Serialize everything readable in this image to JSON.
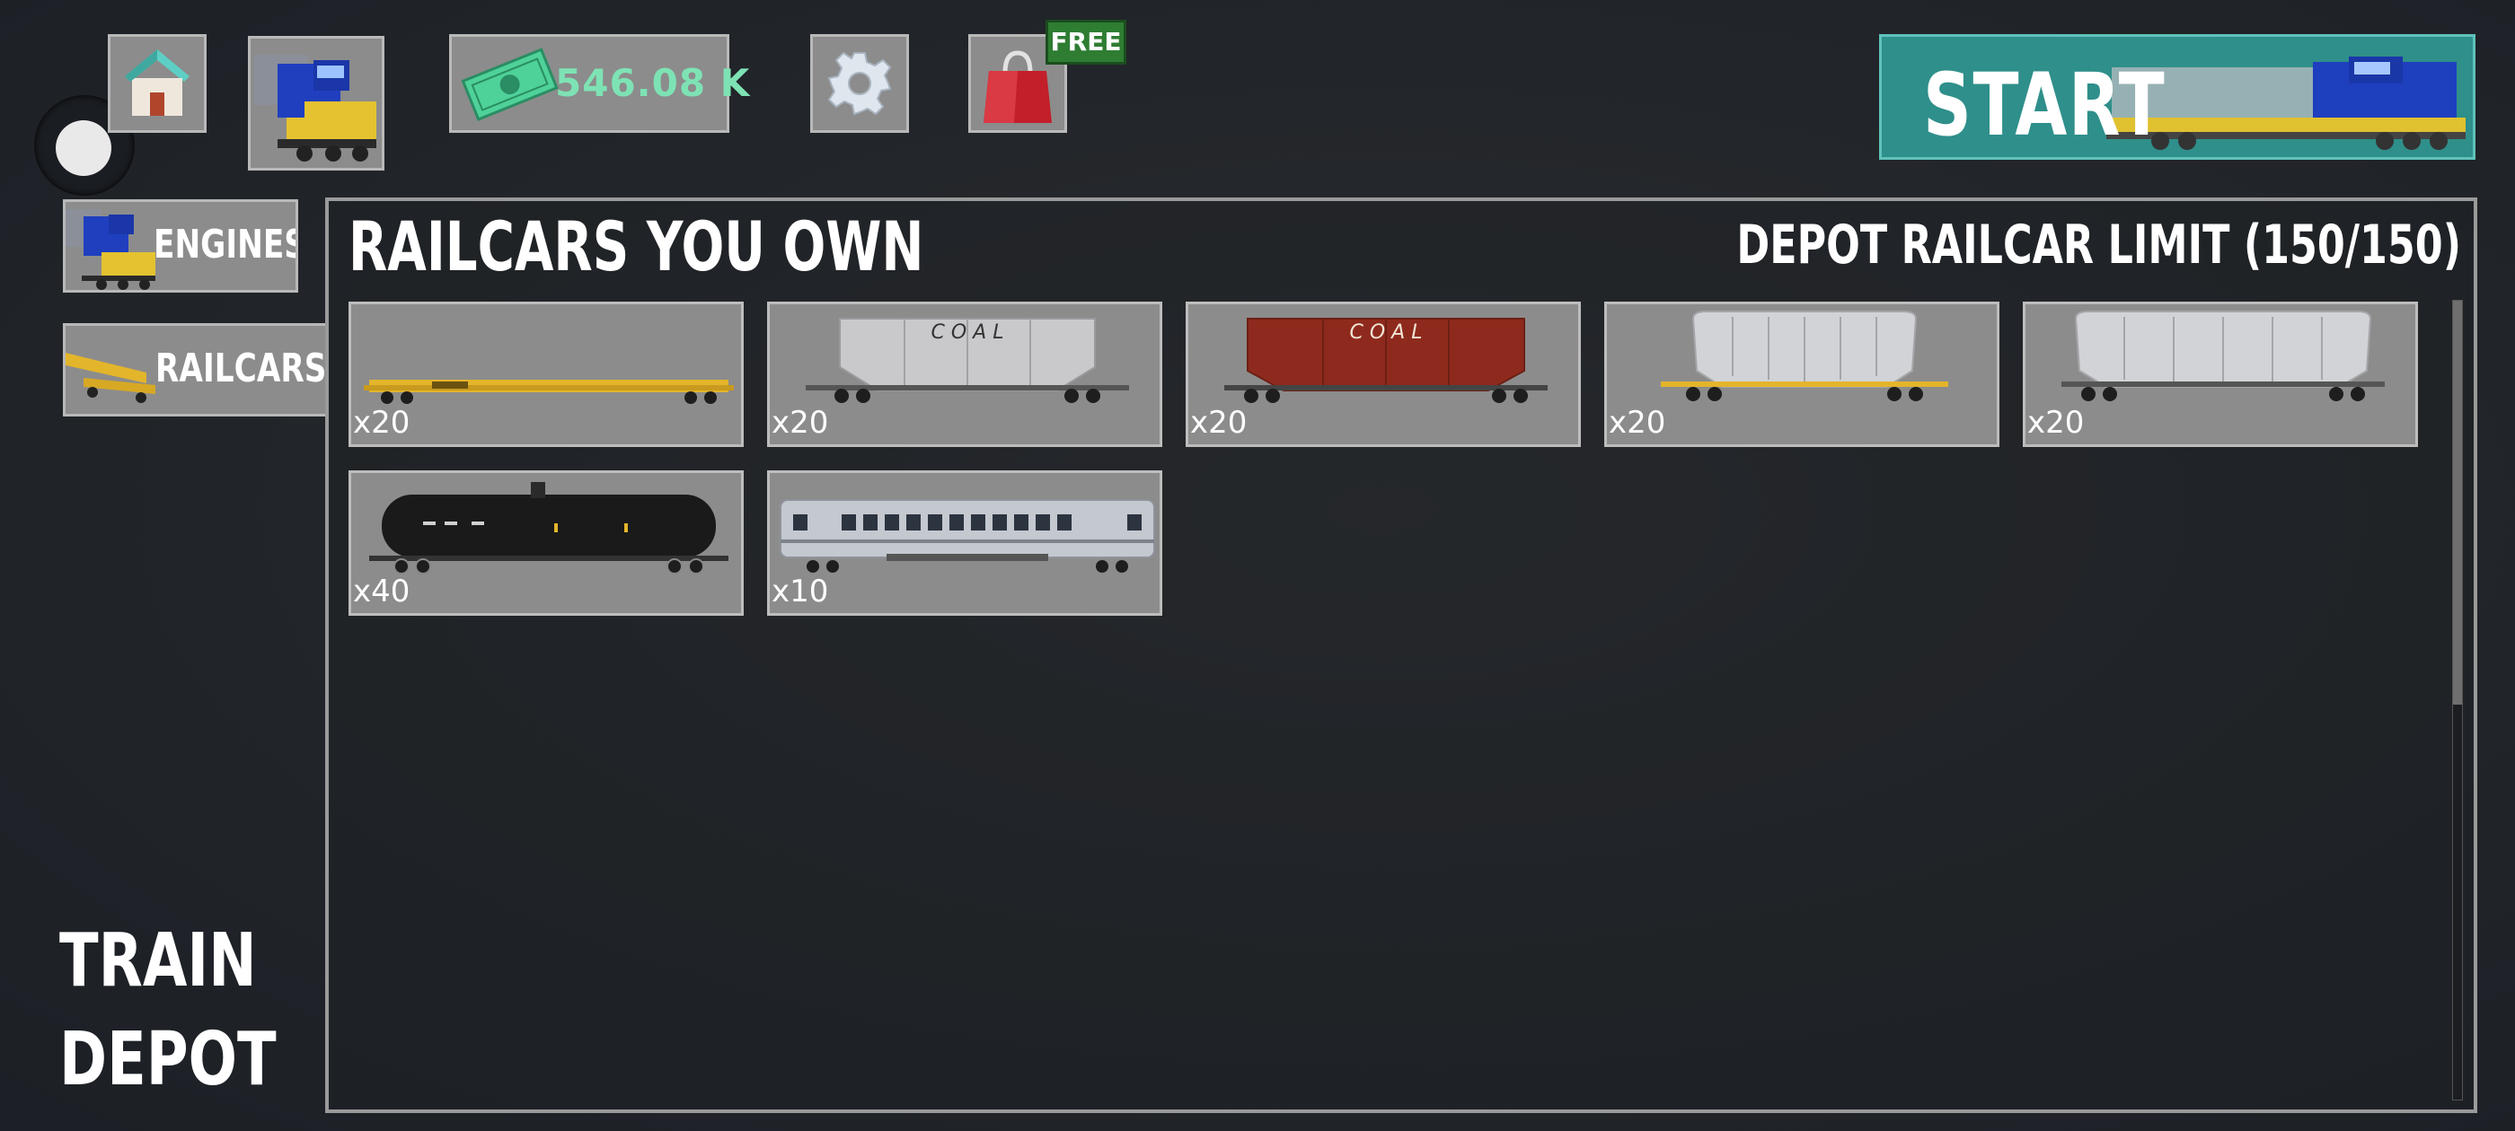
{
  "header": {
    "money": "546.08 K",
    "shop_badge": "FREE",
    "start_label": "START"
  },
  "icons": {
    "home": "house-icon",
    "engine_select": "locomotive-icon",
    "money": "cash-icon",
    "settings": "gear-icon",
    "shop": "shopping-bag-icon"
  },
  "sidebar": {
    "items": [
      {
        "label": "ENGINES"
      },
      {
        "label": "RAILCARS"
      }
    ],
    "title_line1": "TRAIN",
    "title_line2": "DEPOT"
  },
  "panel": {
    "title": "RAILCARS YOU OWN",
    "limit": "DEPOT RAILCAR LIMIT (150/150)",
    "railcars": [
      {
        "type": "flatcar",
        "color": "#e3b52b",
        "qty": "x20"
      },
      {
        "type": "coal-hopper",
        "color": "#c9c9cc",
        "qty": "x20",
        "text": "C O A L"
      },
      {
        "type": "coal-hopper",
        "color": "#8e2a1d",
        "qty": "x20",
        "text": "C O A L"
      },
      {
        "type": "covered-hopper",
        "color": "#d2d3d6",
        "qty": "x20"
      },
      {
        "type": "covered-hopper",
        "color": "#d2d3d6",
        "qty": "x20"
      },
      {
        "type": "tank-car",
        "color": "#1a1a1a",
        "qty": "x40"
      },
      {
        "type": "passenger-car",
        "color": "#c4c8cf",
        "qty": "x10"
      }
    ]
  },
  "colors": {
    "accent_teal": "#2f8f8a",
    "money_green": "#7ee3b4",
    "badge_green": "#2e7d32",
    "tile_gray": "#8c8c8c"
  }
}
